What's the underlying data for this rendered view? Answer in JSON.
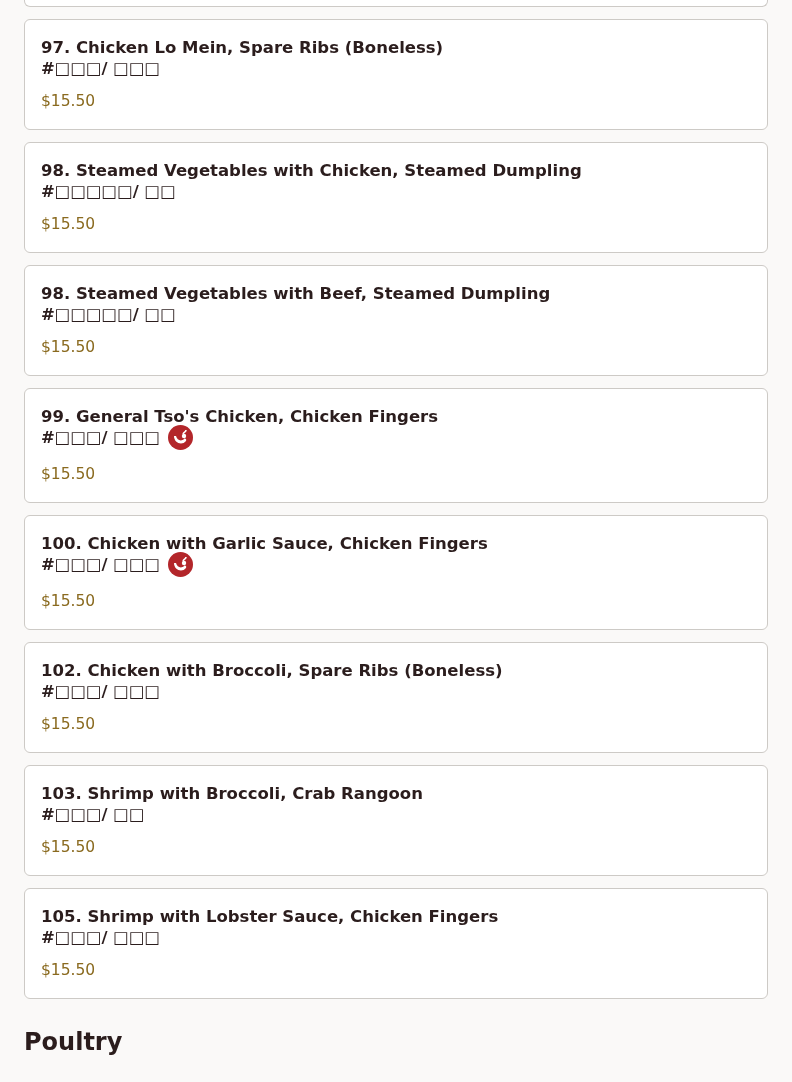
{
  "items": [
    {
      "name": "97. Chicken Lo Mein, Spare Ribs (Boneless)",
      "chinese": "#□□□/ □□□",
      "spicy": false,
      "price": "$15.50"
    },
    {
      "name": "98. Steamed Vegetables with Chicken, Steamed Dumpling",
      "chinese": "#□□□□□/ □□",
      "spicy": false,
      "price": "$15.50"
    },
    {
      "name": "98. Steamed Vegetables with Beef, Steamed Dumpling",
      "chinese": "#□□□□□/ □□",
      "spicy": false,
      "price": "$15.50"
    },
    {
      "name": "99. General Tso's Chicken, Chicken Fingers",
      "chinese": "#□□□/ □□□",
      "spicy": true,
      "price": "$15.50"
    },
    {
      "name": "100. Chicken with Garlic Sauce, Chicken Fingers",
      "chinese": "#□□□/ □□□",
      "spicy": true,
      "price": "$15.50"
    },
    {
      "name": "102. Chicken with Broccoli, Spare Ribs (Boneless)",
      "chinese": "#□□□/ □□□",
      "spicy": false,
      "price": "$15.50"
    },
    {
      "name": "103. Shrimp with Broccoli, Crab Rangoon",
      "chinese": "#□□□/ □□",
      "spicy": false,
      "price": "$15.50"
    },
    {
      "name": "105. Shrimp with Lobster Sauce, Chicken Fingers",
      "chinese": "#□□□/ □□□",
      "spicy": false,
      "price": "$15.50"
    }
  ],
  "section": {
    "title": "Poultry"
  }
}
